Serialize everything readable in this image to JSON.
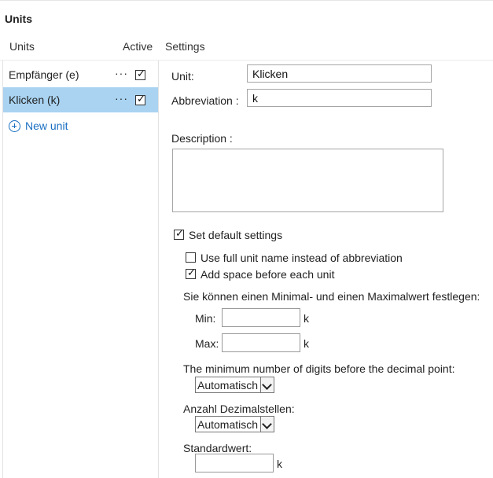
{
  "title": "Units",
  "columns": {
    "units": "Units",
    "active": "Active",
    "settings": "Settings"
  },
  "units": [
    {
      "label": "Empfänger (e)",
      "active": true,
      "selected": false
    },
    {
      "label": "Klicken (k)",
      "active": true,
      "selected": true
    }
  ],
  "row_menu": "···",
  "new_unit_label": "New unit",
  "form": {
    "unit_label": "Unit:",
    "unit_value": "Klicken",
    "abbr_label": "Abbreviation :",
    "abbr_value": "k",
    "description_label": "Description :",
    "description_value": "",
    "default_settings_label": "Set default settings",
    "default_settings_checked": true,
    "full_name_label": "Use full unit name instead of abbreviation",
    "full_name_checked": false,
    "add_space_label": "Add space before each unit",
    "add_space_checked": true,
    "minmax_hint": "Sie können einen Minimal- und einen Maximalwert festlegen:",
    "min_label": "Min:",
    "min_value": "",
    "max_label": "Max:",
    "max_value": "",
    "unit_suffix": "k",
    "min_digits_label": "The minimum number of digits before the decimal point:",
    "min_digits_value": "Automatisch",
    "decimals_label": "Anzahl Dezimalstellen:",
    "decimals_value": "Automatisch",
    "default_value_label": "Standardwert:",
    "default_value": ""
  }
}
